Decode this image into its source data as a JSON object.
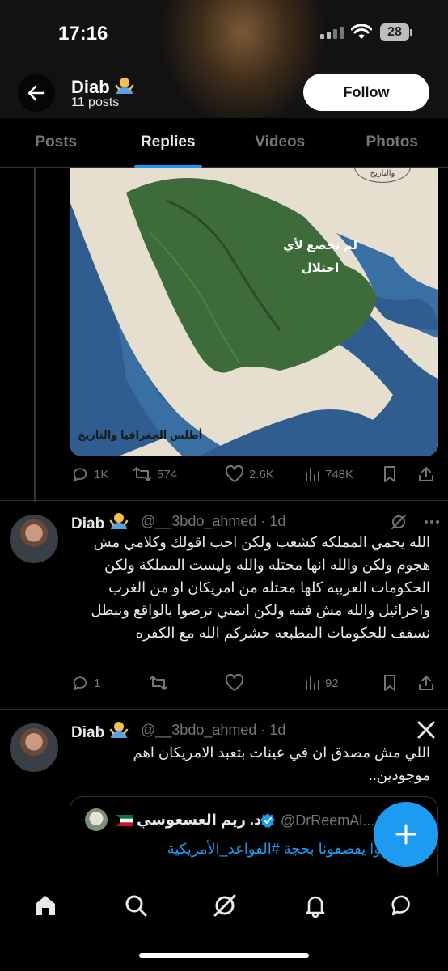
{
  "status_bar": {
    "time": "17:16",
    "battery": "28"
  },
  "profile": {
    "name": "Diab",
    "posts_count": "11 posts",
    "follow_label": "Follow"
  },
  "tabs": [
    {
      "label": "Posts",
      "active": false
    },
    {
      "label": "Replies",
      "active": true
    },
    {
      "label": "Videos",
      "active": false
    },
    {
      "label": "Photos",
      "active": false
    }
  ],
  "first_post": {
    "map_label_line1": "لم تخضع لأي",
    "map_label_line2": "احتلال",
    "map_credit": "أطلس الجغرافيا والتاريخ",
    "map_stamp_text": "والتاريخ",
    "metrics": {
      "replies": "1K",
      "reposts": "574",
      "likes": "2.6K",
      "views": "748K"
    }
  },
  "reply1": {
    "name": "Diab",
    "handle": "@__3bdo_ahmed · 1d",
    "text": "الله يحمي المملكه كشعب ولكن احب اقولك وكلامي مش هجوم ولكن والله انها محتله والله وليست المملكة ولكن الحكومات العربيه كلها محتله من امريكان او من الغرب واخرائيل والله مش فتنه ولكن اتمني ترضوا بالواقع ونبطل نسقف للحكومات المطبعه حشركم الله مع الكفره",
    "metrics": {
      "replies": "1",
      "reposts": "",
      "likes": "",
      "views": "92"
    }
  },
  "reply2": {
    "name": "Diab",
    "handle": "@__3bdo_ahmed · 1d",
    "text": "اللي مش مصدق ان في عينات بتعبد الامريكان اهم موجودين..",
    "quote": {
      "name": "د. ريم العسعوسي",
      "handle": "@DrReemAl...",
      "text": "وا يقصفونا بحجة #القواعد_الأمريكية"
    }
  },
  "colors": {
    "accent": "#1d9bf0",
    "muted": "#71767b",
    "text": "#e7e9ea",
    "background": "#000000"
  },
  "icons": [
    "back-arrow-icon",
    "shrug-emoji-icon",
    "reply-icon",
    "repost-icon",
    "like-icon",
    "views-icon",
    "bookmark-icon",
    "share-icon",
    "grok-icon",
    "x-logo-icon",
    "verified-icon",
    "kuwait-flag-icon",
    "compose-plus-icon",
    "home-icon",
    "search-icon",
    "notifications-icon",
    "messages-icon"
  ]
}
